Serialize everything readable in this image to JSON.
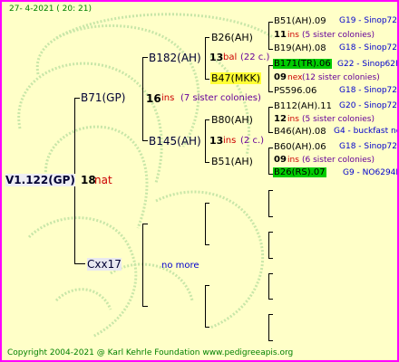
{
  "header": {
    "date": "27-   4-2021  ( 20:  21)"
  },
  "root": {
    "name": "V1.122(GP)",
    "count": "18",
    "tag": "nat"
  },
  "gen1": [
    {
      "name": "B71(GP)",
      "count": "16",
      "tag": "ins",
      "note": "(7 sister colonies)"
    },
    {
      "name": "Cxx17",
      "note": "no more"
    }
  ],
  "gen2": [
    {
      "name": "B182(AH)"
    },
    {
      "name": "B145(AH)"
    }
  ],
  "gen3": [
    {
      "name": "B26(AH)",
      "count": "13",
      "tag": "bal",
      "note": "(22 c.)"
    },
    {
      "name": "B47(MKK)"
    },
    {
      "name": "B80(AH)",
      "count": "13",
      "tag": "ins",
      "note": "(2 c.)"
    },
    {
      "name": "B51(AH)"
    }
  ],
  "gen4": [
    {
      "name": "B51(AH).09",
      "line": "G19 - Sinop72R"
    },
    {
      "count": "11",
      "tag": "ins",
      "note": "(5 sister colonies)"
    },
    {
      "name": "B19(AH).08",
      "line": "G18 - Sinop72R"
    },
    {
      "name": "B171(TR).06",
      "line": "G22 - Sinop62R"
    },
    {
      "count": "09",
      "tag": "nex",
      "note": "(12 sister colonies)"
    },
    {
      "name": "PS596.06",
      "line": "G18 - Sinop72R"
    },
    {
      "name": "B112(AH).11",
      "line": "G20 - Sinop72R"
    },
    {
      "count": "12",
      "tag": "ins",
      "note": "(5 sister colonies)"
    },
    {
      "name": "B46(AH).08",
      "line": "G4 - buckfast no"
    },
    {
      "name": "B60(AH).06",
      "line": "G18 - Sinop72R"
    },
    {
      "count": "09",
      "tag": "ins",
      "note": "(6 sister colonies)"
    },
    {
      "name": "B26(RS).07",
      "line": "G9 - NO6294R"
    }
  ],
  "footer": {
    "copyright": "Copyright 2004-2021 @ Karl Kehrle Foundation    www.pedigreeapis.org"
  },
  "colors": {
    "border": "#ff00ff",
    "background": "#ffffc8",
    "yellow_highlight": "#ffff33",
    "green_highlight": "#00cc00",
    "watermark": "#c8e6a8"
  }
}
